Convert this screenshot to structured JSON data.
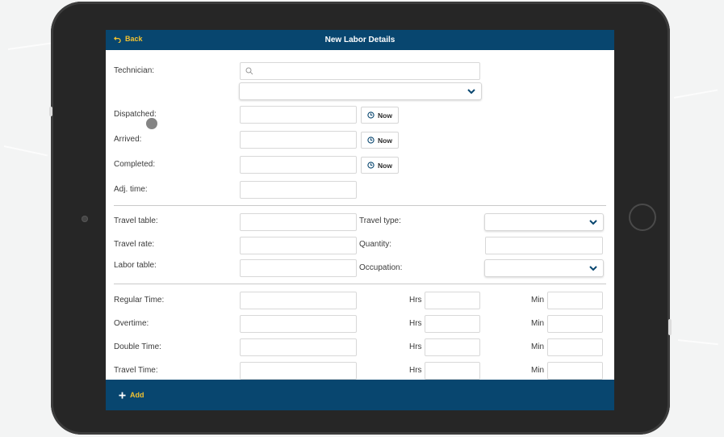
{
  "header": {
    "back_label": "Back",
    "title": "New Labor Details"
  },
  "footer": {
    "add_label": "Add"
  },
  "timing": {
    "technician_label": "Technician:",
    "dispatched_label": "Dispatched:",
    "arrived_label": "Arrived:",
    "completed_label": "Completed:",
    "adj_time_label": "Adj. time:",
    "now_label": "Now"
  },
  "rates": {
    "travel_table_label": "Travel table:",
    "travel_type_label": "Travel type:",
    "travel_rate_label": "Travel rate:",
    "quantity_label": "Quantity:",
    "labor_table_label": "Labor table:",
    "occupation_label": "Occupation:"
  },
  "hours": {
    "rows": [
      {
        "label": "Regular Time:"
      },
      {
        "label": "Overtime:"
      },
      {
        "label": "Double Time:"
      },
      {
        "label": "Travel Time:"
      }
    ],
    "hrs_label": "Hrs",
    "min_label": "Min"
  },
  "colors": {
    "header_bg": "#08466f",
    "accent_yellow": "#f2c230",
    "device_frame": "#262626"
  }
}
